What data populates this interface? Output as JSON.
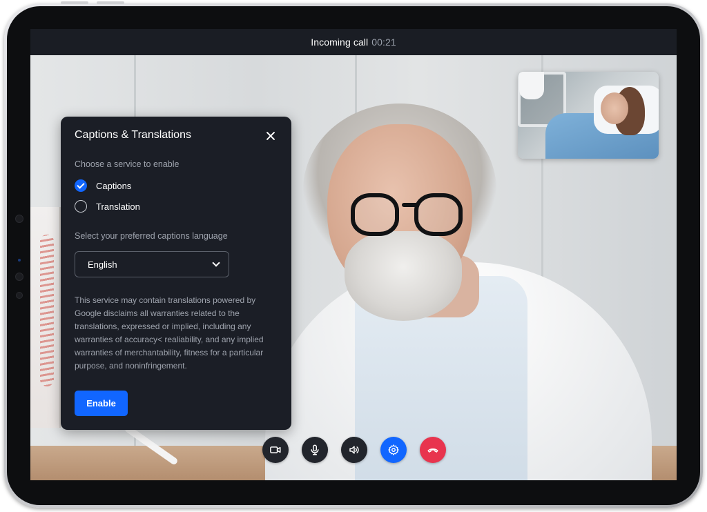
{
  "call": {
    "status_label": "Incoming call",
    "timer": "00:21"
  },
  "panel": {
    "title": "Captions & Translations",
    "choose_label": "Choose a service to enable",
    "options": [
      {
        "label": "Captions",
        "selected": true
      },
      {
        "label": "Translation",
        "selected": false
      }
    ],
    "language_label": "Select your preferred captions language",
    "language_value": "English",
    "disclaimer": "This service may contain translations powered by Google disclaims all warranties related to the translations, expressed or implied, including any warranties of accuracy< realiability, and any implied warranties of merchantability, fitness for a particular purpose, and noninfringement.",
    "enable_label": "Enable"
  },
  "controls": [
    {
      "name": "camera-icon",
      "color": "#22252c"
    },
    {
      "name": "microphone-icon",
      "color": "#22252c"
    },
    {
      "name": "speaker-icon",
      "color": "#22252c"
    },
    {
      "name": "settings-icon",
      "color": "#1166ff"
    },
    {
      "name": "end-call-icon",
      "color": "#e8344e"
    }
  ],
  "colors": {
    "accent": "#1166ff",
    "danger": "#e8344e",
    "panel_bg": "#1b1e26"
  }
}
